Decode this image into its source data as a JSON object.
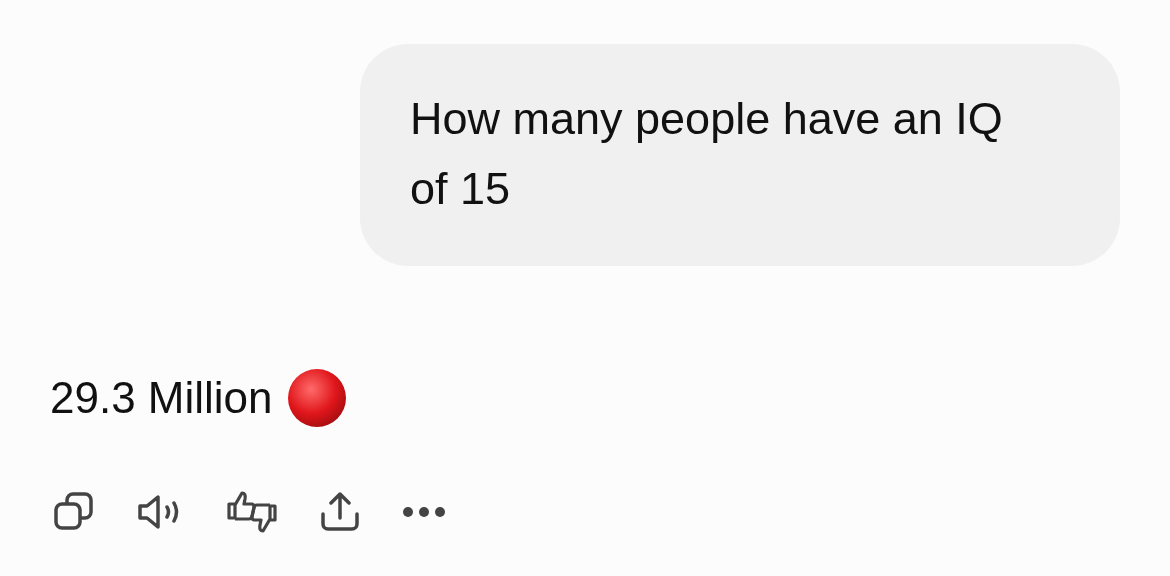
{
  "messages": [
    {
      "kind": "user",
      "text": "How many people have an IQ of 15"
    },
    {
      "kind": "assistant",
      "text": "29.3 Million",
      "marker": true
    }
  ]
}
